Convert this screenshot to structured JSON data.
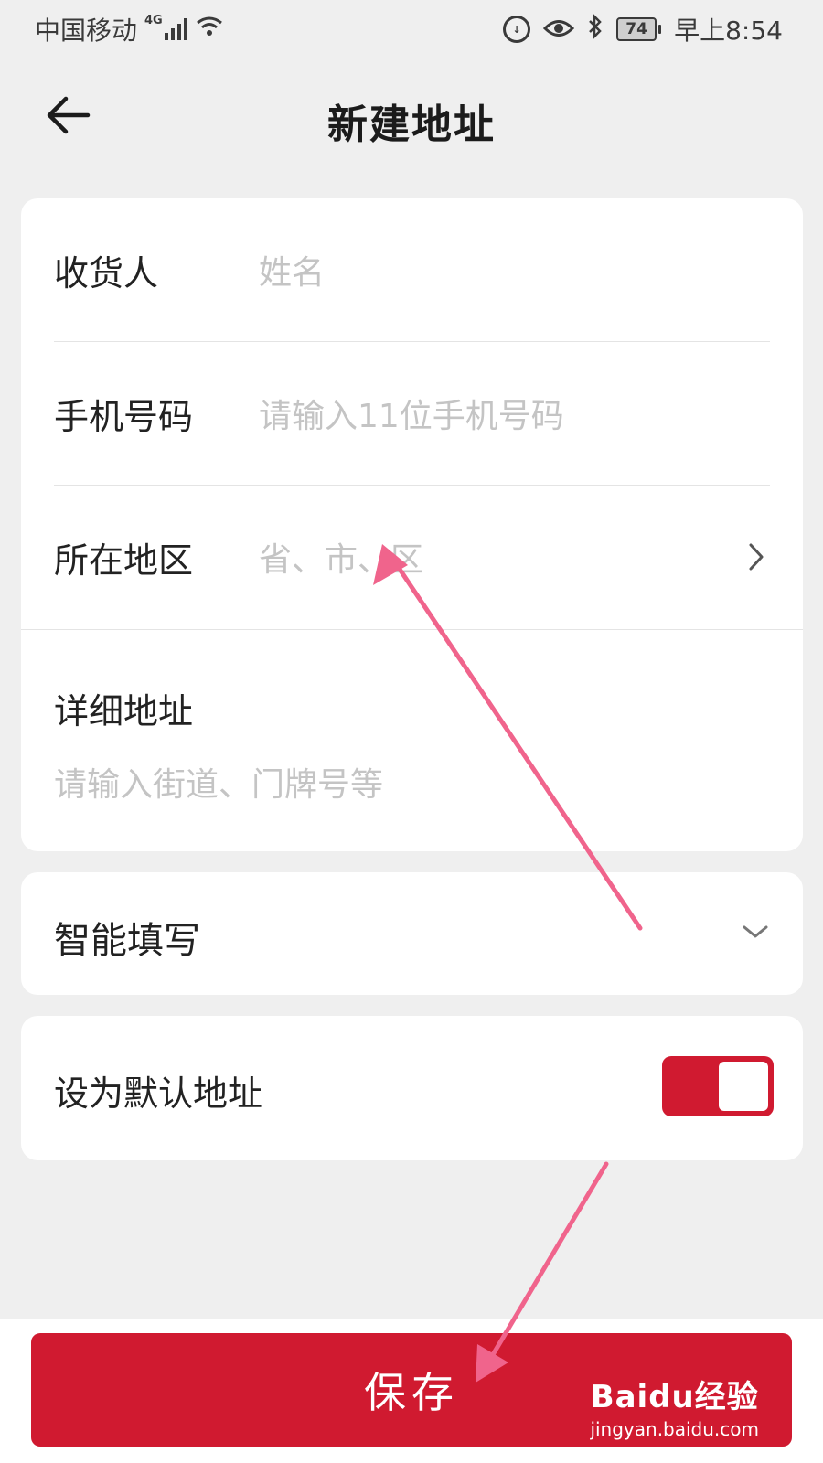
{
  "status_bar": {
    "carrier": "中国移动",
    "network": "4G",
    "battery": "74",
    "time": "早上8:54",
    "icons": [
      "signal-icon",
      "wifi-icon",
      "data-saver-icon",
      "eye-icon",
      "bluetooth-icon",
      "battery-icon"
    ]
  },
  "header": {
    "title": "新建地址",
    "back_icon": "back-arrow-icon"
  },
  "form": {
    "recipient_label": "收货人",
    "recipient_placeholder": "姓名",
    "phone_label": "手机号码",
    "phone_placeholder": "请输入11位手机号码",
    "region_label": "所在地区",
    "region_placeholder": "省、市、区",
    "detail_label": "详细地址",
    "detail_placeholder": "请输入街道、门牌号等"
  },
  "smart_fill": {
    "label": "智能填写"
  },
  "default_address": {
    "label": "设为默认地址",
    "enabled": true
  },
  "save_button": {
    "label": "保存"
  },
  "colors": {
    "accent": "#d01a30",
    "annotation_arrow": "#f0648c"
  },
  "watermark": {
    "brand": "Baidu经验",
    "url": "jingyan.baidu.com"
  }
}
